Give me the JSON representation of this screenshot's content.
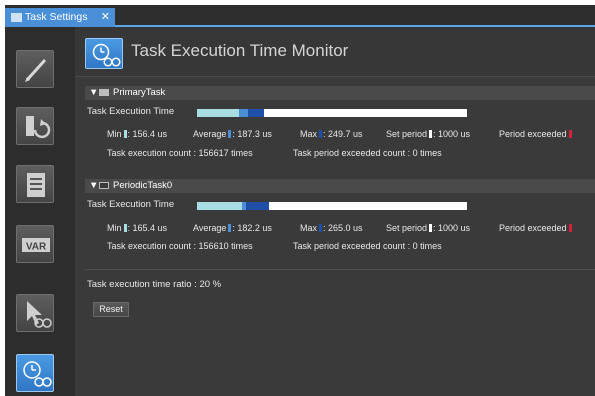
{
  "tab": {
    "label": "Task Settings",
    "close": "✕"
  },
  "sidebar": {
    "items": [
      {
        "name": "edit",
        "icon": "pencil-icon"
      },
      {
        "name": "program-assignment",
        "icon": "task-arrow-icon"
      },
      {
        "name": "list",
        "icon": "list-icon"
      },
      {
        "name": "variables",
        "icon": "var-icon",
        "label": "VAR"
      },
      {
        "name": "monitor-tasks",
        "icon": "cursor-glasses-icon"
      },
      {
        "name": "execution-time-monitor",
        "icon": "clock-glasses-icon",
        "active": true
      }
    ]
  },
  "header": {
    "title": "Task Execution Time Monitor",
    "icon": "clock-glasses-icon"
  },
  "tasks": [
    {
      "name": "PrimaryTask",
      "row_label": "Task Execution Time",
      "bar": {
        "min": 156.4,
        "avg": 187.3,
        "max": 249.7,
        "set_period": 1000
      },
      "min_label": "Min",
      "min_value": ": 156.4 us",
      "avg_label": "Average",
      "avg_value": ": 187.3 us",
      "max_label": "Max",
      "max_value": ": 249.7 us",
      "set_label": "Set period",
      "set_value": ": 1000 us",
      "exceeded_label": "Period exceeded",
      "count_text": "Task execution count : 156617 times",
      "exceeded_count_text": "Task period exceeded count : 0 times"
    },
    {
      "name": "PeriodicTask0",
      "row_label": "Task Execution Time",
      "bar": {
        "min": 165.4,
        "avg": 182.2,
        "max": 265.0,
        "set_period": 1000
      },
      "min_label": "Min",
      "min_value": ": 165.4 us",
      "avg_label": "Average",
      "avg_value": ": 182.2 us",
      "max_label": "Max",
      "max_value": ": 265.0 us",
      "set_label": "Set period",
      "set_value": ": 1000 us",
      "exceeded_label": "Period exceeded",
      "count_text": "Task execution count : 156610 times",
      "exceeded_count_text": "Task period exceeded count : 0 times"
    }
  ],
  "ratio_text": "Task execution time ratio : 20 %",
  "reset_label": "Reset",
  "colors": {
    "accent": "#4a90d9",
    "min": "#a8dde4",
    "avg": "#4a8fd6",
    "max": "#1f4fa8",
    "exceeded": "#d8203a"
  }
}
